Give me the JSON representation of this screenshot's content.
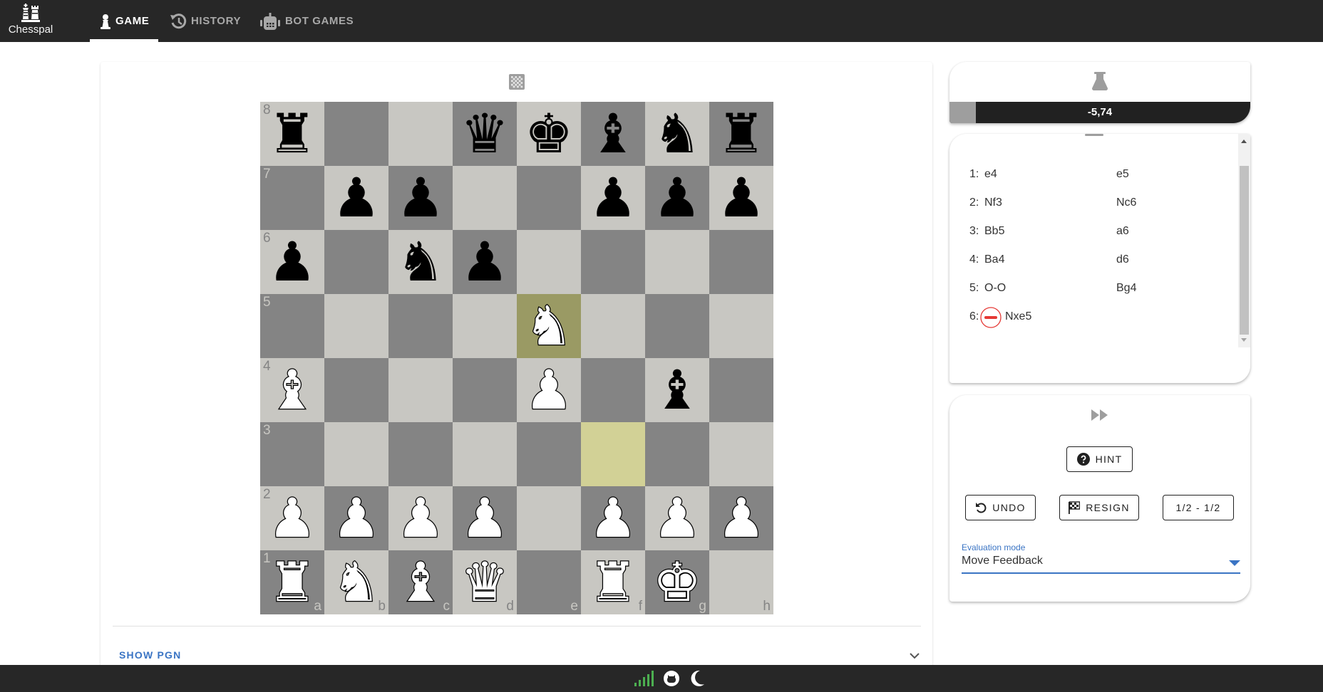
{
  "app": {
    "name": "Chesspal",
    "nav": [
      {
        "label": "GAME",
        "icon": "pawn-icon",
        "active": true
      },
      {
        "label": "HISTORY",
        "icon": "history-icon",
        "active": false
      },
      {
        "label": "BOT GAMES",
        "icon": "robot-icon",
        "active": false
      }
    ]
  },
  "board": {
    "orientation": "white",
    "flip_icon": "checkerboard-icon",
    "ranks": [
      "8",
      "7",
      "6",
      "5",
      "4",
      "3",
      "2",
      "1"
    ],
    "files": [
      "a",
      "b",
      "c",
      "d",
      "e",
      "f",
      "g",
      "h"
    ],
    "position": [
      [
        "r",
        "",
        "",
        "q",
        "k",
        "b",
        "n",
        "r"
      ],
      [
        "",
        "p",
        "p",
        "",
        "",
        "p",
        "p",
        "p"
      ],
      [
        "p",
        "",
        "n",
        "p",
        "",
        "",
        "",
        ""
      ],
      [
        "",
        "",
        "",
        "",
        "N",
        "",
        "",
        ""
      ],
      [
        "B",
        "",
        "",
        "",
        "P",
        "",
        "b",
        ""
      ],
      [
        "",
        "",
        "",
        "",
        "",
        "",
        "",
        ""
      ],
      [
        "P",
        "P",
        "P",
        "P",
        "",
        "P",
        "P",
        "P"
      ],
      [
        "R",
        "N",
        "B",
        "Q",
        "",
        "R",
        "K",
        ""
      ]
    ],
    "last_move": {
      "from": "f3",
      "to": "e5"
    },
    "colors": {
      "light": "#c8c7c2",
      "dark": "#848484",
      "highlight_from": "#d2d196",
      "highlight_to": "#9a9a64"
    }
  },
  "pgn": {
    "toggle_label": "SHOW PGN",
    "expanded": false
  },
  "evaluation": {
    "icon": "flask-icon",
    "value_text": "-5,74",
    "white_share": 0.088
  },
  "moves": [
    {
      "num": "1:",
      "white": "e4",
      "black": "e5"
    },
    {
      "num": "2:",
      "white": "Nf3",
      "black": "Nc6"
    },
    {
      "num": "3:",
      "white": "Bb5",
      "black": "a6"
    },
    {
      "num": "4:",
      "white": "Ba4",
      "black": "d6"
    },
    {
      "num": "5:",
      "white": "O-O",
      "black": "Bg4"
    },
    {
      "num": "6:",
      "white": "Nxe5",
      "black": "",
      "white_feedback": "blunder",
      "feedback_color": "#e53935"
    }
  ],
  "controls": {
    "fast_forward_icon": "fast-forward-icon",
    "hint_label": "HINT",
    "undo_label": "UNDO",
    "resign_label": "RESIGN",
    "draw_label": "1/2 - 1/2",
    "evaluation_mode": {
      "label": "Evaluation mode",
      "value": "Move Feedback"
    }
  },
  "footer": {
    "icons": [
      "connection-signal-icon",
      "github-icon",
      "dark-mode-icon"
    ],
    "signal_color": "#4caf50"
  }
}
